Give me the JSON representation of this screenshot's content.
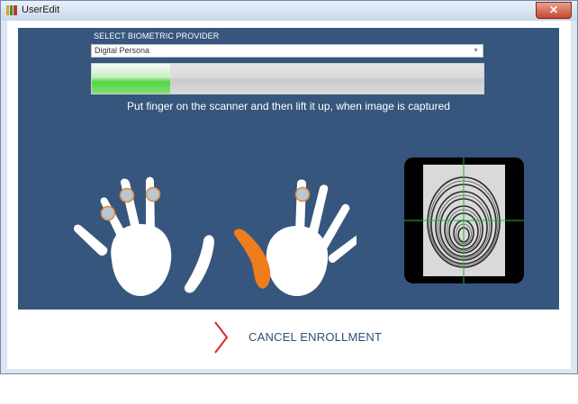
{
  "window": {
    "title": "UserEdit",
    "close_glyph": "✕"
  },
  "provider": {
    "label": "SELECT BIOMETRIC PROVIDER",
    "selected": "Digital Persona"
  },
  "capture": {
    "progress_percent": 20,
    "instruction": "Put finger on the scanner and then lift it up, when image is captured"
  },
  "hands": {
    "left_hand_enrolled_fingers": [
      "index",
      "middle",
      "ring"
    ],
    "right_hand_enrolled_fingers": [
      "index"
    ],
    "active_finger": "right-thumb",
    "colors": {
      "hand": "#ffffff",
      "active": "#f07d1c",
      "enrolled_ring": "#e08a3a"
    }
  },
  "scanner": {
    "icon": "fingerprint-icon",
    "crosshair_color": "#1fb53a"
  },
  "actions": {
    "cancel_label": "CANCEL ENROLLMENT",
    "cancel_icon": "chevron-right-icon",
    "cancel_icon_color": "#d42a2a"
  }
}
